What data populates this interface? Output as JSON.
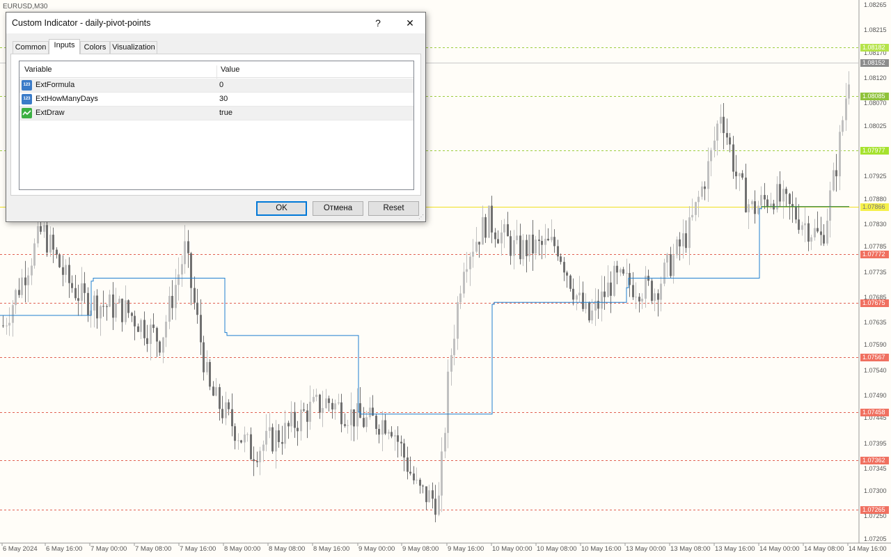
{
  "chart": {
    "symbol_label": "EURUSD,M30",
    "price_ticks": [
      "1.08265",
      "1.08215",
      "1.08170",
      "1.08120",
      "1.08070",
      "1.08025",
      "1.07975",
      "1.07925",
      "1.07880",
      "1.07830",
      "1.07785",
      "1.07735",
      "1.07685",
      "1.07635",
      "1.07590",
      "1.07540",
      "1.07490",
      "1.07445",
      "1.07395",
      "1.07345",
      "1.07300",
      "1.07250",
      "1.07205"
    ],
    "level_tags": [
      {
        "value": "1.08182",
        "color": "#b5e34a"
      },
      {
        "value": "1.08152",
        "color": "#8c8c8c"
      },
      {
        "value": "1.08085",
        "color": "#8fc23b"
      },
      {
        "value": "1.07977",
        "color": "#a6e22e"
      },
      {
        "value": "1.07866",
        "color": "#f5f04a"
      },
      {
        "value": "1.07772",
        "color": "#f07060"
      },
      {
        "value": "1.07675",
        "color": "#f07060"
      },
      {
        "value": "1.07567",
        "color": "#f07060"
      },
      {
        "value": "1.07458",
        "color": "#f07060"
      },
      {
        "value": "1.07362",
        "color": "#f07060"
      },
      {
        "value": "1.07265",
        "color": "#f07060"
      }
    ],
    "time_ticks": [
      "6 May 2024",
      "6 May 16:00",
      "7 May 00:00",
      "7 May 08:00",
      "7 May 16:00",
      "8 May 00:00",
      "8 May 08:00",
      "8 May 16:00",
      "9 May 00:00",
      "9 May 08:00",
      "9 May 16:00",
      "10 May 00:00",
      "10 May 08:00",
      "10 May 16:00",
      "13 May 00:00",
      "13 May 08:00",
      "13 May 16:00",
      "14 May 00:00",
      "14 May 08:00",
      "14 May 16:00"
    ],
    "colors": {
      "pivot_line": "#1f7fd0",
      "resistance_line": "#9ccc3c",
      "support_line": "#e06050",
      "today_pivot": "#f0e020",
      "candle_bull": "#c0c0c0",
      "candle_bear": "#707070"
    }
  },
  "dialog": {
    "title": "Custom Indicator - daily-pivot-points",
    "help_label": "?",
    "close_label": "✕",
    "tabs": [
      {
        "label": "Common",
        "active": false
      },
      {
        "label": "Inputs",
        "active": true
      },
      {
        "label": "Colors",
        "active": false
      },
      {
        "label": "Visualization",
        "active": false
      }
    ],
    "grid": {
      "col_variable": "Variable",
      "col_value": "Value",
      "rows": [
        {
          "icon": "number-icon",
          "name": "ExtFormula",
          "value": "0"
        },
        {
          "icon": "number-icon",
          "name": "ExtHowManyDays",
          "value": "30"
        },
        {
          "icon": "boolean-icon",
          "name": "ExtDraw",
          "value": "true"
        }
      ]
    },
    "buttons": {
      "ok": "OK",
      "cancel": "Отмена",
      "reset": "Reset"
    }
  }
}
